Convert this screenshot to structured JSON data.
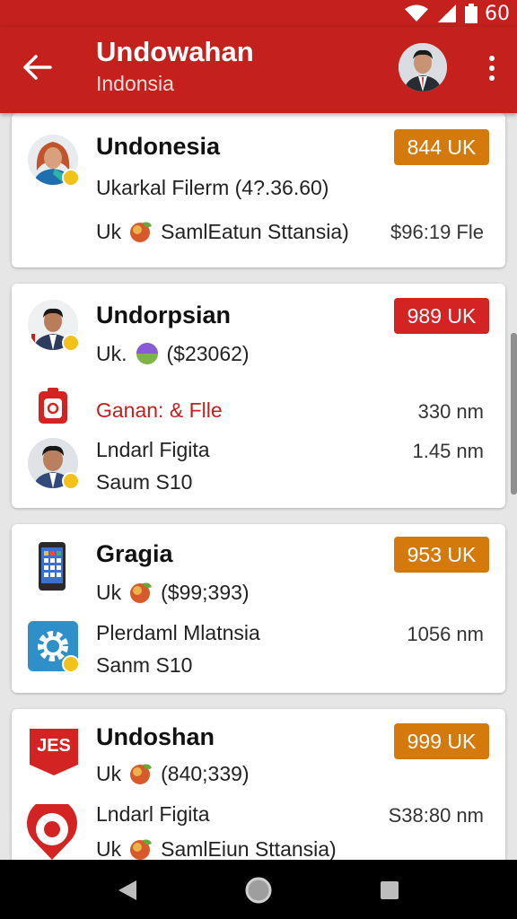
{
  "status_bar": {
    "time": "60"
  },
  "app_bar": {
    "title": "Undowahan",
    "subtitle": "Indonsia"
  },
  "cards": [
    {
      "title": "Undonesia",
      "badge": "844 UK",
      "line1": "Ukarkal Filerm (4?.36.60)",
      "line2_prefix": "Uk",
      "line2_text": "SamlEatun Sttansia)",
      "line2_value": "$96:19 Fle"
    },
    {
      "title": "Undorpsian",
      "badge": "989 UK",
      "line1_prefix": "Uk.",
      "line1_text": "($23062)",
      "row2_label": "Ganan: & Flle",
      "row2_value": "330 nm",
      "row3_label": "Lndarl Figita",
      "row3_value": "1.45 nm",
      "row3_sub": "Saum S10"
    },
    {
      "title": "Gragia",
      "badge": "953 UK",
      "line1_prefix": "Uk",
      "line1_text": "($99;393)",
      "row2_label": "Plerdaml Mlatnsia",
      "row2_value": "1056 nm",
      "row2_sub": "Sanm S10"
    },
    {
      "title": "Undoshan",
      "badge": "999 UK",
      "logo_text": "JES",
      "line1_prefix": "Uk",
      "line1_text": "(840;339)",
      "row2_label": "Lndarl Figita",
      "row2_value": "S38:80 nm",
      "row2_sub_prefix": "Uk",
      "row2_sub_text": "SamlEiun Sttansia)"
    }
  ],
  "colors": {
    "primary": "#c4201d",
    "badge_orange": "#d47a0c",
    "badge_red": "#d42323",
    "nav": "#000000"
  },
  "icons": {
    "status": [
      "wifi-icon",
      "signal-icon",
      "battery-icon"
    ],
    "app_bar": [
      "back-arrow-icon",
      "overflow-menu-icon"
    ],
    "nav": [
      "back-triangle-icon",
      "home-circle-icon",
      "recents-square-icon"
    ]
  }
}
